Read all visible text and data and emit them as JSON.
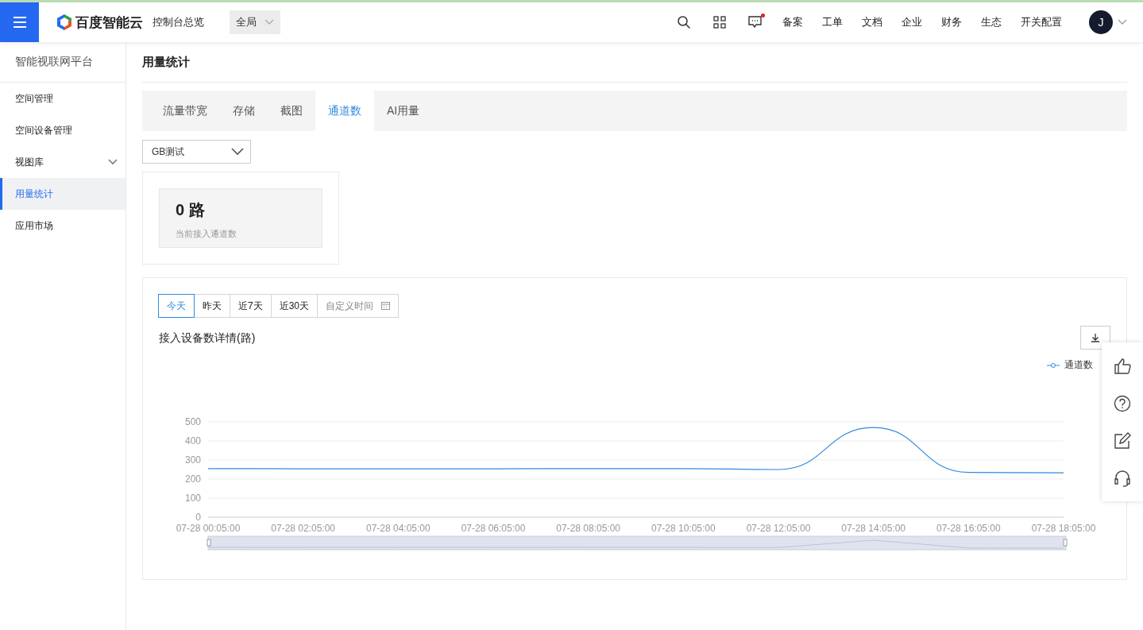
{
  "header": {
    "brand": "百度智能云",
    "console": "控制台总览",
    "region": "全局",
    "nav": [
      "备案",
      "工单",
      "文档",
      "企业",
      "财务",
      "生态",
      "开关配置"
    ],
    "message_unread": true,
    "avatar": "J"
  },
  "sidebar": {
    "title": "智能视联网平台",
    "items": [
      {
        "label": "空间管理",
        "selected": false,
        "expandable": false
      },
      {
        "label": "空间设备管理",
        "selected": false,
        "expandable": false
      },
      {
        "label": "视图库",
        "selected": false,
        "expandable": true
      },
      {
        "label": "用量统计",
        "selected": true,
        "expandable": false
      },
      {
        "label": "应用市场",
        "selected": false,
        "expandable": false
      }
    ]
  },
  "page_title": "用量统计",
  "tabs": [
    {
      "label": "流量带宽",
      "selected": false
    },
    {
      "label": "存储",
      "selected": false
    },
    {
      "label": "截图",
      "selected": false
    },
    {
      "label": "通道数",
      "selected": true
    },
    {
      "label": "AI用量",
      "selected": false
    }
  ],
  "space_select": "GB测试",
  "stat": {
    "value": "0 路",
    "label": "当前接入通道数"
  },
  "ranges": [
    {
      "label": "今天",
      "selected": true
    },
    {
      "label": "昨天",
      "selected": false
    },
    {
      "label": "近7天",
      "selected": false
    },
    {
      "label": "近30天",
      "selected": false
    }
  ],
  "custom_range": "自定义时间",
  "chart_title": "接入设备数详情(路)",
  "chart_data": {
    "type": "line",
    "categories": [
      "07-28 00:05:00",
      "07-28 02:05:00",
      "07-28 04:05:00",
      "07-28 06:05:00",
      "07-28 08:05:00",
      "07-28 10:05:00",
      "07-28 12:05:00",
      "07-28 14:05:00",
      "07-28 16:05:00",
      "07-28 18:05:00"
    ],
    "series": [
      {
        "name": "通道数",
        "color": "#2f8ae0",
        "values": [
          255,
          254,
          254,
          254,
          255,
          255,
          250,
          470,
          235,
          233
        ]
      }
    ],
    "ylim": [
      0,
      500
    ],
    "yticks": [
      0,
      100,
      200,
      300,
      400,
      500
    ],
    "grid": true
  }
}
